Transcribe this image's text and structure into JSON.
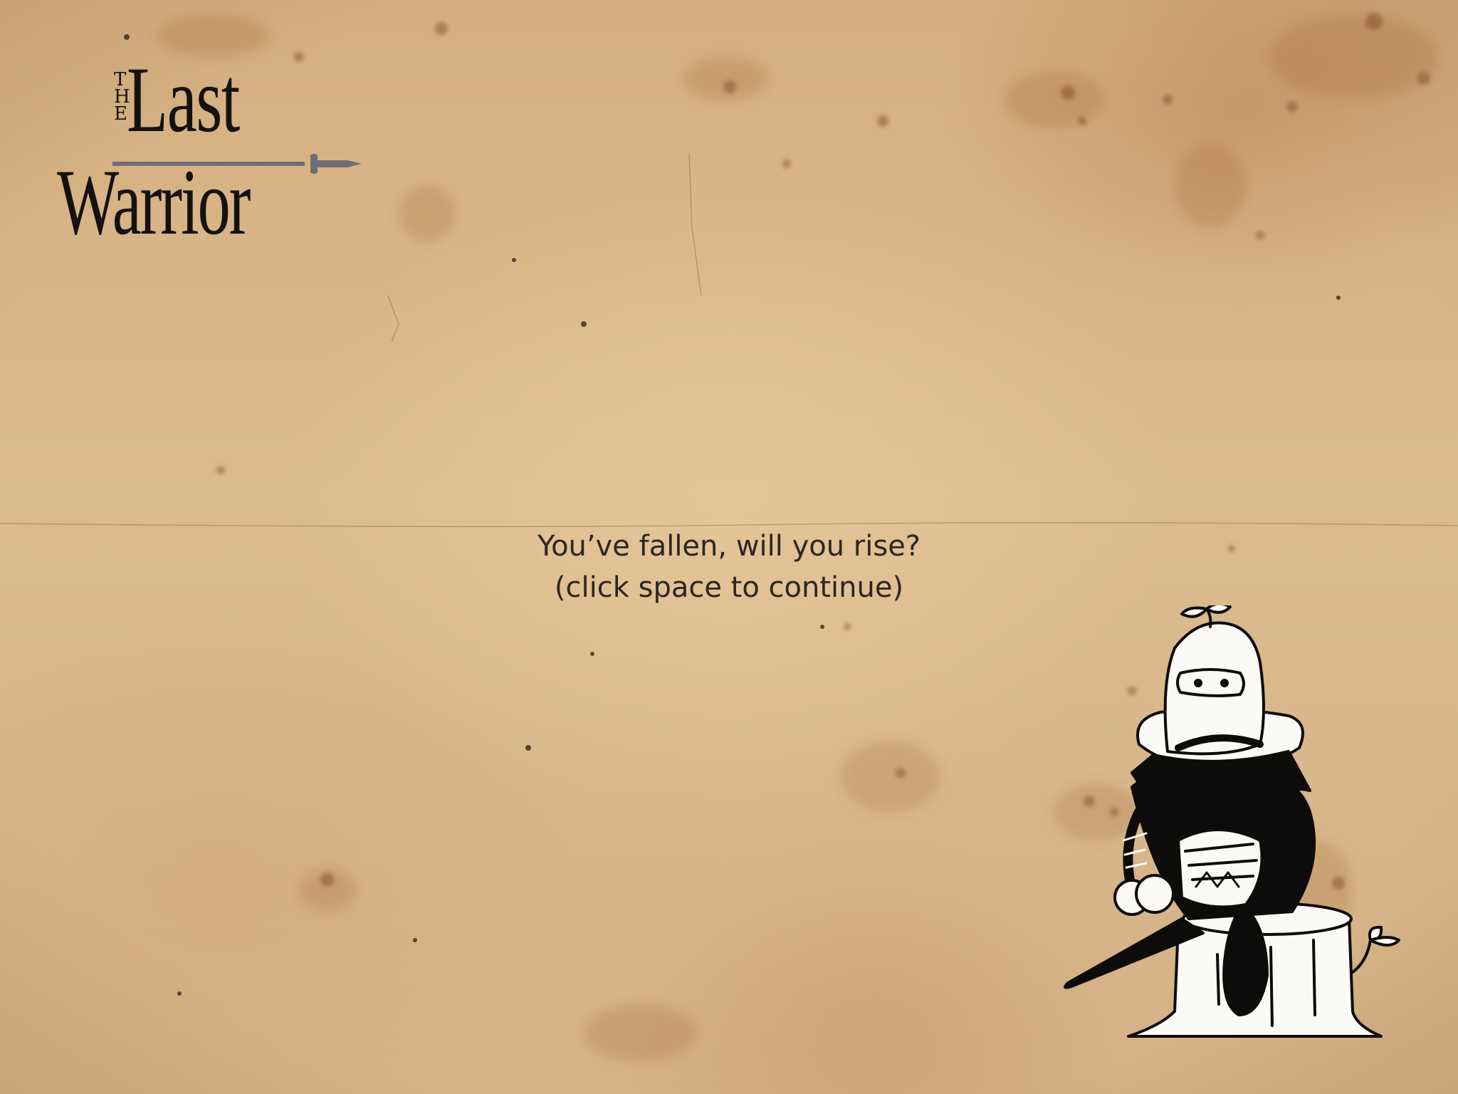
{
  "game": {
    "logo": {
      "the": "THE",
      "last": "Last",
      "warrior": "Warrior"
    },
    "message": {
      "line1": "You’ve fallen, will you rise?",
      "line2": "(click space to continue)"
    },
    "character": "seated-knight-on-stump",
    "colors": {
      "parchment": "#d9b98e",
      "ink": "#141210",
      "text": "#2b2722",
      "sword": "#6f6e78"
    }
  }
}
